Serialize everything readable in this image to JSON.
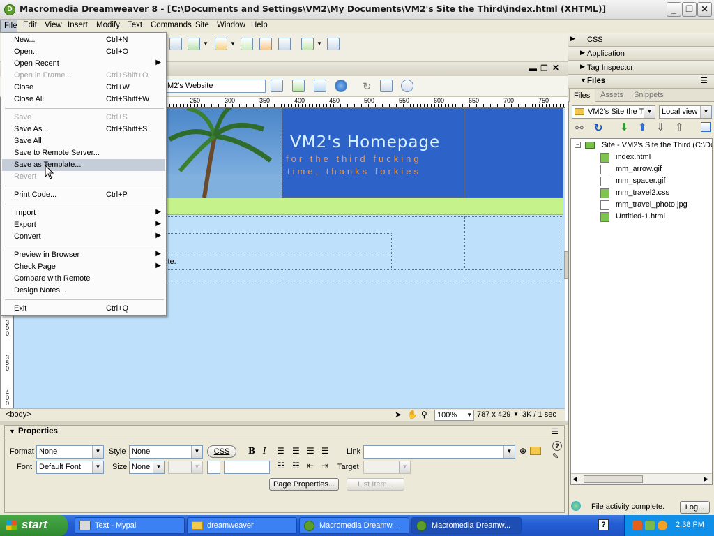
{
  "window": {
    "title": "Macromedia Dreamweaver 8 - [C:\\Documents and Settings\\VM2\\My Documents\\VM2's Site the Third\\index.html (XHTML)]"
  },
  "menubar": [
    "File",
    "Edit",
    "View",
    "Insert",
    "Modify",
    "Text",
    "Commands",
    "Site",
    "Window",
    "Help"
  ],
  "file_menu": [
    {
      "label": "New...",
      "shortcut": "Ctrl+N",
      "enabled": true
    },
    {
      "label": "Open...",
      "shortcut": "Ctrl+O",
      "enabled": true
    },
    {
      "label": "Open Recent",
      "shortcut": "",
      "submenu": true,
      "enabled": true
    },
    {
      "label": "Open in Frame...",
      "shortcut": "Ctrl+Shift+O",
      "enabled": false
    },
    {
      "label": "Close",
      "shortcut": "Ctrl+W",
      "enabled": true
    },
    {
      "label": "Close All",
      "shortcut": "Ctrl+Shift+W",
      "enabled": true
    },
    {
      "label": "Save",
      "shortcut": "Ctrl+S",
      "enabled": false
    },
    {
      "label": "Save As...",
      "shortcut": "Ctrl+Shift+S",
      "enabled": true
    },
    {
      "label": "Save All",
      "shortcut": "",
      "enabled": true
    },
    {
      "label": "Save to Remote Server...",
      "shortcut": "",
      "enabled": true
    },
    {
      "label": "Save as Template...",
      "shortcut": "",
      "enabled": true,
      "highlighted": true
    },
    {
      "label": "Revert",
      "shortcut": "",
      "enabled": false
    },
    {
      "label": "Print Code...",
      "shortcut": "Ctrl+P",
      "enabled": true
    },
    {
      "label": "Import",
      "shortcut": "",
      "submenu": true,
      "enabled": true
    },
    {
      "label": "Export",
      "shortcut": "",
      "submenu": true,
      "enabled": true
    },
    {
      "label": "Convert",
      "shortcut": "",
      "submenu": true,
      "enabled": true
    },
    {
      "label": "Preview in Browser",
      "shortcut": "",
      "submenu": true,
      "enabled": true
    },
    {
      "label": "Check Page",
      "shortcut": "",
      "submenu": true,
      "enabled": true
    },
    {
      "label": "Compare with Remote",
      "shortcut": "",
      "enabled": true
    },
    {
      "label": "Design Notes...",
      "shortcut": "",
      "enabled": true
    },
    {
      "label": "Exit",
      "shortcut": "Ctrl+Q",
      "enabled": true
    }
  ],
  "document": {
    "page_title_field": "M2's Website",
    "ruler_ticks": [
      "250",
      "300",
      "350",
      "400",
      "450",
      "500",
      "550",
      "600",
      "650",
      "700",
      "750"
    ],
    "vruler_ticks": [
      "300",
      "350",
      "400"
    ],
    "heading": "VM2's Homepage",
    "subheading_1": "for the third fucking",
    "subheading_2": "time, thanks forkies",
    "body_fragment": "ite.",
    "tag_selector": "<body>",
    "zoom": "100%",
    "dimensions": "787 x 429",
    "download": "3K / 1 sec"
  },
  "properties": {
    "title": "Properties",
    "format_label": "Format",
    "format_value": "None",
    "style_label": "Style",
    "style_value": "None",
    "css_button": "CSS",
    "bold": "B",
    "italic": "I",
    "link_label": "Link",
    "font_label": "Font",
    "font_value": "Default Font",
    "size_label": "Size",
    "size_value": "None",
    "target_label": "Target",
    "page_properties_button": "Page Properties...",
    "list_item_button": "List Item..."
  },
  "right_panel": {
    "css": "CSS",
    "application": "Application",
    "tag_inspector": "Tag Inspector",
    "files": "Files",
    "tabs": [
      "Files",
      "Assets",
      "Snippets"
    ],
    "site_select": "VM2's Site the Th",
    "view_select": "Local view",
    "site_root": "Site - VM2's Site the Third (C:\\Doc",
    "file_items": [
      "index.html",
      "mm_arrow.gif",
      "mm_spacer.gif",
      "mm_travel2.css",
      "mm_travel_photo.jpg",
      "Untitled-1.html"
    ],
    "status": "File activity complete.",
    "log_button": "Log..."
  },
  "taskbar": {
    "start": "start",
    "tasks": [
      "Text - Mypal",
      "dreamweaver",
      "Macromedia Dreamw...",
      "Macromedia Dreamw..."
    ],
    "clock": "2:38 PM"
  },
  "colors": {
    "banner": "#2d63c8",
    "canvas": "#bfe0fb",
    "greenbar": "#c5f28a",
    "heading": "#d9f0ff",
    "subheading": "#f29a4a"
  }
}
